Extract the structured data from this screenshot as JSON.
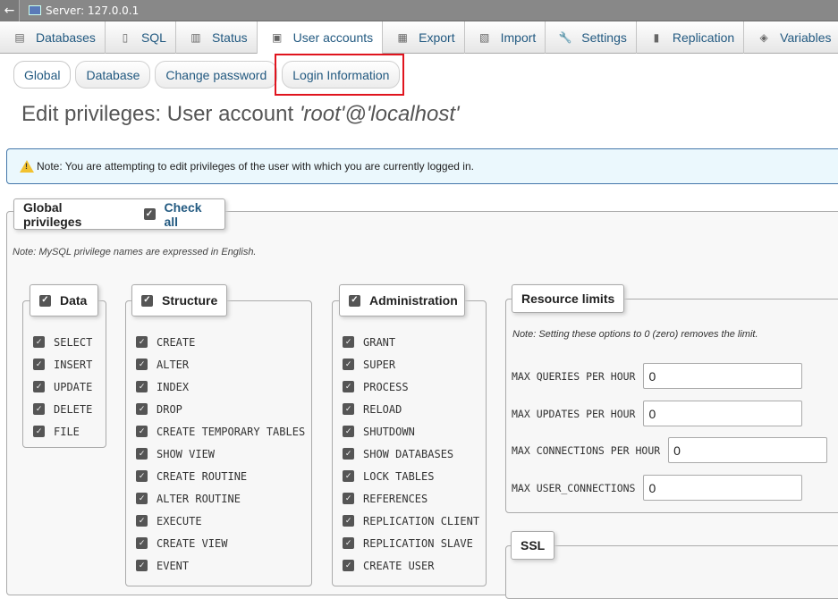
{
  "server_bar": {
    "title": "Server: 127.0.0.1",
    "back_glyph": "←"
  },
  "topmenu": [
    {
      "label": "Databases",
      "icon": "database-icon",
      "glyph": "▤"
    },
    {
      "label": "SQL",
      "icon": "sql-icon",
      "glyph": "▯"
    },
    {
      "label": "Status",
      "icon": "status-icon",
      "glyph": "▥"
    },
    {
      "label": "User accounts",
      "icon": "users-icon",
      "glyph": "▣"
    },
    {
      "label": "Export",
      "icon": "export-icon",
      "glyph": "▦"
    },
    {
      "label": "Import",
      "icon": "import-icon",
      "glyph": "▧"
    },
    {
      "label": "Settings",
      "icon": "wrench-icon",
      "glyph": "🔧"
    },
    {
      "label": "Replication",
      "icon": "replication-icon",
      "glyph": "▮"
    },
    {
      "label": "Variables",
      "icon": "variables-icon",
      "glyph": "◈"
    }
  ],
  "subtabs": [
    "Global",
    "Database",
    "Change password",
    "Login Information"
  ],
  "page": {
    "title_prefix": "Edit privileges: User account ",
    "account": "'root'@'localhost'"
  },
  "notice": "Note: You are attempting to edit privileges of the user with which you are currently logged in.",
  "global_privileges": {
    "legend": "Global privileges",
    "check_all": "Check all",
    "note": "Note: MySQL privilege names are expressed in English."
  },
  "groups": {
    "data": {
      "label": "Data",
      "items": [
        "SELECT",
        "INSERT",
        "UPDATE",
        "DELETE",
        "FILE"
      ]
    },
    "structure": {
      "label": "Structure",
      "items": [
        "CREATE",
        "ALTER",
        "INDEX",
        "DROP",
        "CREATE TEMPORARY TABLES",
        "SHOW VIEW",
        "CREATE ROUTINE",
        "ALTER ROUTINE",
        "EXECUTE",
        "CREATE VIEW",
        "EVENT"
      ]
    },
    "administration": {
      "label": "Administration",
      "items": [
        "GRANT",
        "SUPER",
        "PROCESS",
        "RELOAD",
        "SHUTDOWN",
        "SHOW DATABASES",
        "LOCK TABLES",
        "REFERENCES",
        "REPLICATION CLIENT",
        "REPLICATION SLAVE",
        "CREATE USER"
      ]
    }
  },
  "resource_limits": {
    "legend": "Resource limits",
    "note": "Note: Setting these options to 0 (zero) removes the limit.",
    "fields": [
      {
        "label": "MAX QUERIES PER HOUR",
        "value": "0"
      },
      {
        "label": "MAX UPDATES PER HOUR",
        "value": "0"
      },
      {
        "label": "MAX CONNECTIONS PER HOUR",
        "value": "0"
      },
      {
        "label": "MAX USER_CONNECTIONS",
        "value": "0"
      }
    ]
  },
  "ssl": {
    "legend": "SSL"
  },
  "colors": {
    "link": "#235a81",
    "highlight": "#e0141e",
    "notice_bg": "#ebf8fd"
  }
}
